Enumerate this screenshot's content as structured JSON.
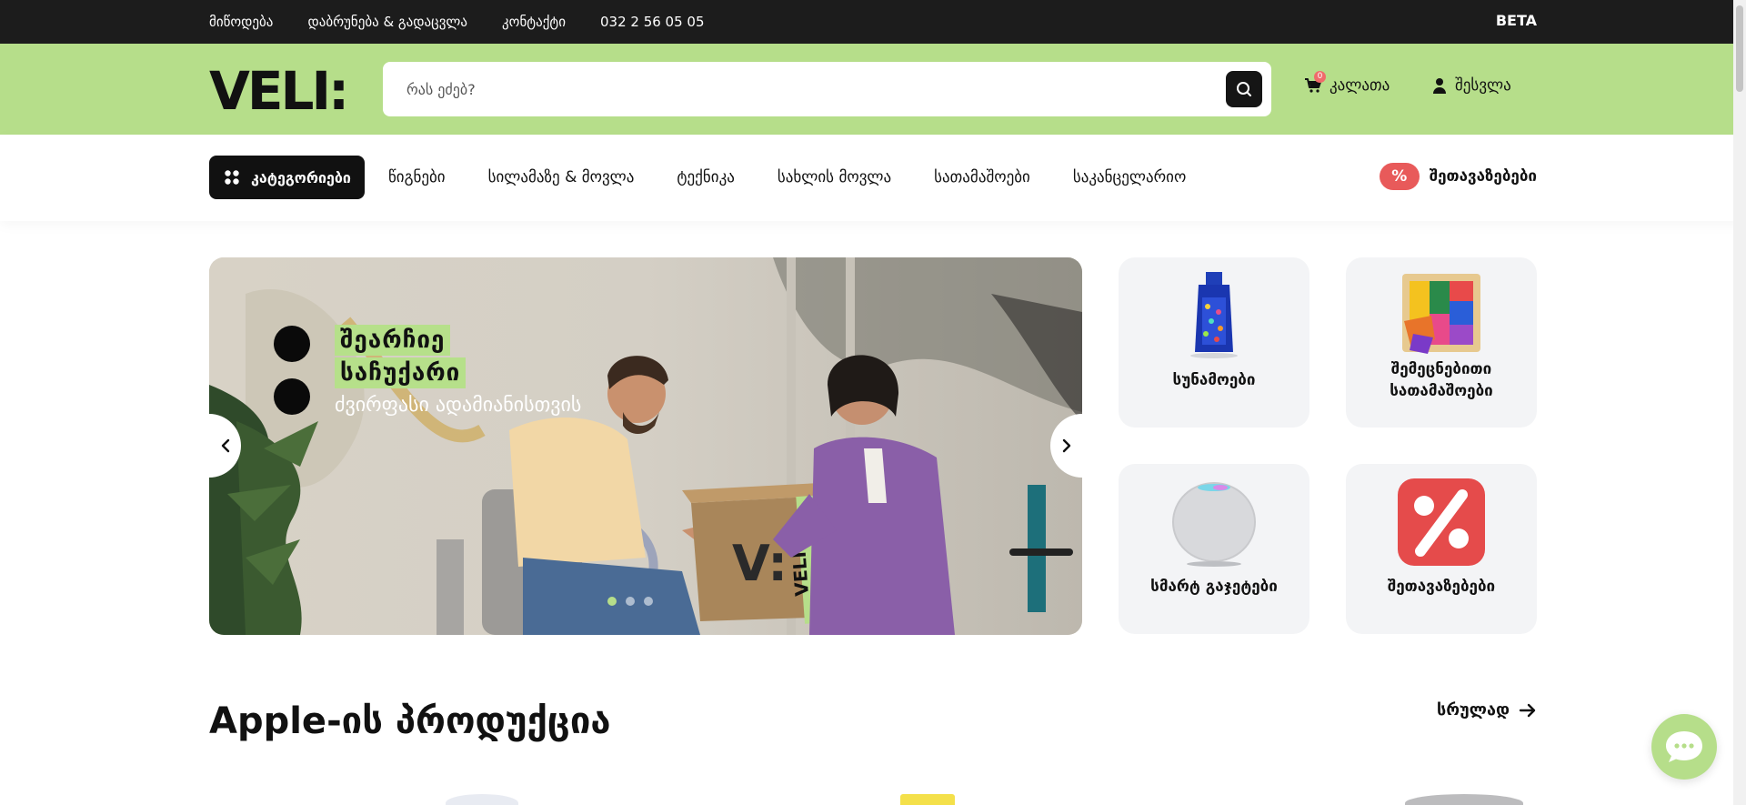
{
  "topbar": {
    "links": [
      "მიწოდება",
      "დაბრუნება & გადაცვლა",
      "კონტაქტი",
      "032 2 56 05 05"
    ],
    "beta": "BETA"
  },
  "header": {
    "logo_text": "VELI:",
    "search_placeholder": "რას ეძებ?",
    "cart_label": "კალათა",
    "cart_count": "0",
    "login_label": "შესვლა",
    "brand_color": "#b6de8a"
  },
  "nav": {
    "categories_label": "კატეგორიები",
    "links": [
      "წიგნები",
      "სილამაზე & მოვლა",
      "ტექნიკა",
      "სახლის მოვლა",
      "სათამაშოები",
      "საკანცელარიო"
    ],
    "offers_label": "შეთავაზებები",
    "offers_badge": "%"
  },
  "hero": {
    "title_line1": "შეარჩიე",
    "title_line2": "საჩუქარი",
    "subtitle": "ძვირფასი ადამიანისთვის",
    "box_text": "V:",
    "box_tape": "VELI:",
    "slides": 3,
    "active_slide": 0
  },
  "tiles": [
    {
      "label": "სუნამოები",
      "icon": "perfume-icon"
    },
    {
      "label": "შემეცნებითი სათამაშოები",
      "icon": "puzzle-icon"
    },
    {
      "label": "სმარტ გაჯეტები",
      "icon": "smart-speaker-icon"
    },
    {
      "label": "შეთავაზებები",
      "icon": "percent-icon"
    }
  ],
  "section": {
    "title": "Apple-ის პროდუქცია",
    "more_label": "სრულად"
  }
}
